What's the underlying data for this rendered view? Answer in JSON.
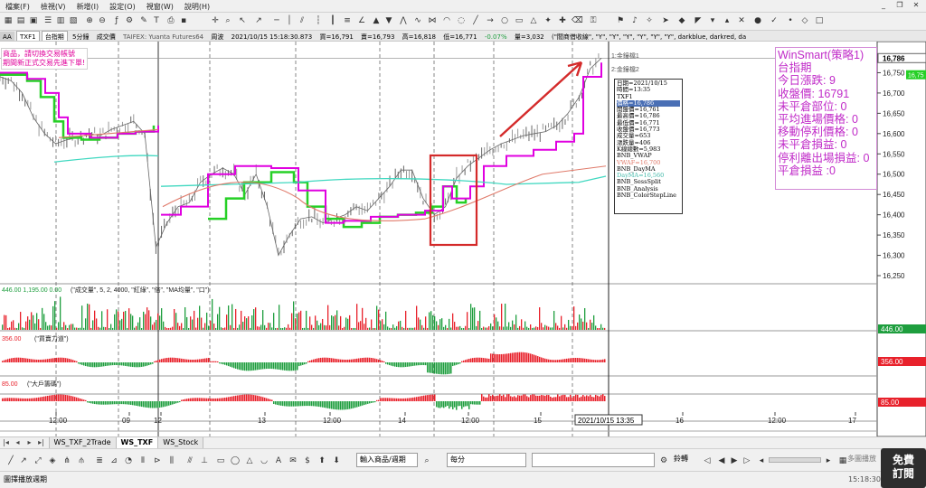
{
  "menu": [
    "檔案(F)",
    "檢視(V)",
    "新增(I)",
    "設定(O)",
    "視窗(W)",
    "說明(H)"
  ],
  "quote_bar": {
    "zoom": "AA",
    "symbol": "TXF1",
    "product": "台指期",
    "period": "5分鐘",
    "chart_type": "成交價",
    "source": "TAIFEX: Yuanta Futures64",
    "period_label": "周波",
    "datetime": "2021/10/15 15:18:30.873",
    "bid_label": "買=16,791",
    "ask_label": "賣=16,793",
    "high_label": "高=16,818",
    "low_label": "低=16,771",
    "pct_label": "-0.07%",
    "volume_label": "量=3,032",
    "params": "(\"閻商借收線\", \"Y\", \"Y\", \"Y\", \"Y\", \"Y\", \"Y\", darkblue, darkred, da"
  },
  "notice": {
    "line1": "商品，請切換交易帳號",
    "line2": "期間新正式交易先進下單!"
  },
  "datatip": {
    "date": "日期=2021/10/15",
    "time": "時間=13:35",
    "symbol": "TXF1",
    "price": "價格=16,786",
    "open": "開盤價=16,761",
    "high": "最高價=16,786",
    "low": "最低價=16,771",
    "close": "收盤價=16,773",
    "vol": "成交量=653",
    "chg": "漲跌量=406",
    "kline": "K線總數=5,983",
    "vwap": "BNB_VWAP",
    "vwaf": "VWAF=16,700",
    "daymm": "BNB_DayMA",
    "dayma": "DayMA=16,560",
    "setsplit": "BNB_SessSplit",
    "analysis": "BNB_Analysis",
    "colorstep": "BNB_ColorStepLine"
  },
  "strategy": {
    "title": "WinSmart(策略1)",
    "subtitle": "台指期",
    "today_change": "今日漲跌: 9",
    "close_price": "收盤價: 16791",
    "open_position": "未平倉部位: 0",
    "avg_entry": "平均進場價格: 0",
    "trailing_stop": "移動停利價格: 0",
    "unrealized": "未平倉損益: 0",
    "stop_exit_pnl": "停利離出場損益: 0",
    "closed_pnl": "平倉損益 :0"
  },
  "price_axis": [
    "16,750",
    "16,700",
    "16,650",
    "16,600",
    "16,550",
    "16,500",
    "16,450",
    "16,400",
    "16,350",
    "16,300",
    "16,250"
  ],
  "price_axis_top": "16,786",
  "price_right_tag": "16,75",
  "markers": {
    "m1": "1:金鐘檔1",
    "m2": "2:金鐘檔2"
  },
  "volume_panel": {
    "header_values": "446.00 1,195.00 0.00",
    "params": "(\"成交量\", 5, 2, 4000, \"紅綠\", \"倍\", \"MA均量\", \"口\")",
    "tag": "446.00"
  },
  "power_panel": {
    "header_value": "356.00",
    "params": "(\"買賣力道\")",
    "tag": "356.00"
  },
  "whale_panel": {
    "header_value": "85.00",
    "params": "(\"大戶籌碼\")",
    "tag": "85.00"
  },
  "time_axis": [
    "12:00",
    "09",
    "12",
    "13",
    "12:00",
    "14",
    "12:00",
    "15",
    "16",
    "12:00",
    "17"
  ],
  "cursor_time": "2021/10/15 13:35",
  "tabs": [
    "WS_TXF_2Trade",
    "WS_TXF",
    "WS_Stock"
  ],
  "active_tab": "WS_TXF",
  "bottom_toolbar": {
    "product_input": "輸入商品/週期",
    "period_select": "每分",
    "order_label": "鈴轉",
    "playback_label": "多圖播放"
  },
  "status_text": "圖擇播放週期",
  "status_time": "15:18:30",
  "free_button": [
    "免費",
    "訂閱"
  ],
  "colors": {
    "up": "#e8212b",
    "down": "#1e9e3e",
    "magenta_line": "#e000e0",
    "green_line": "#26d026",
    "cyan_line": "#40d8c0",
    "salmon_line": "#e07a6a",
    "highlight_box": "#d42a2a",
    "strategy_text": "#c02bc8"
  },
  "chart_data": {
    "type": "line",
    "title": "台指期 TXF1 5分鐘",
    "ylim": [
      16230,
      16800
    ],
    "price_series": [
      16740,
      16730,
      16700,
      16640,
      16600,
      16575,
      16585,
      16590,
      16600,
      16595,
      16610,
      16620,
      16630,
      16600,
      16320,
      16380,
      16420,
      16430,
      16480,
      16500,
      16515,
      16500,
      16450,
      16500,
      16420,
      16300,
      16350,
      16390,
      16395,
      16380,
      16390,
      16400,
      16420,
      16410,
      16440,
      16470,
      16510,
      16510,
      16440,
      16400,
      16420,
      16490,
      16520,
      16540,
      16560,
      16575,
      16585,
      16595,
      16600,
      16605,
      16620,
      16650,
      16690,
      16760,
      16786
    ],
    "vwap_level_day1": 16540,
    "vwap_level_day2": 16485,
    "last_price": 16786
  }
}
